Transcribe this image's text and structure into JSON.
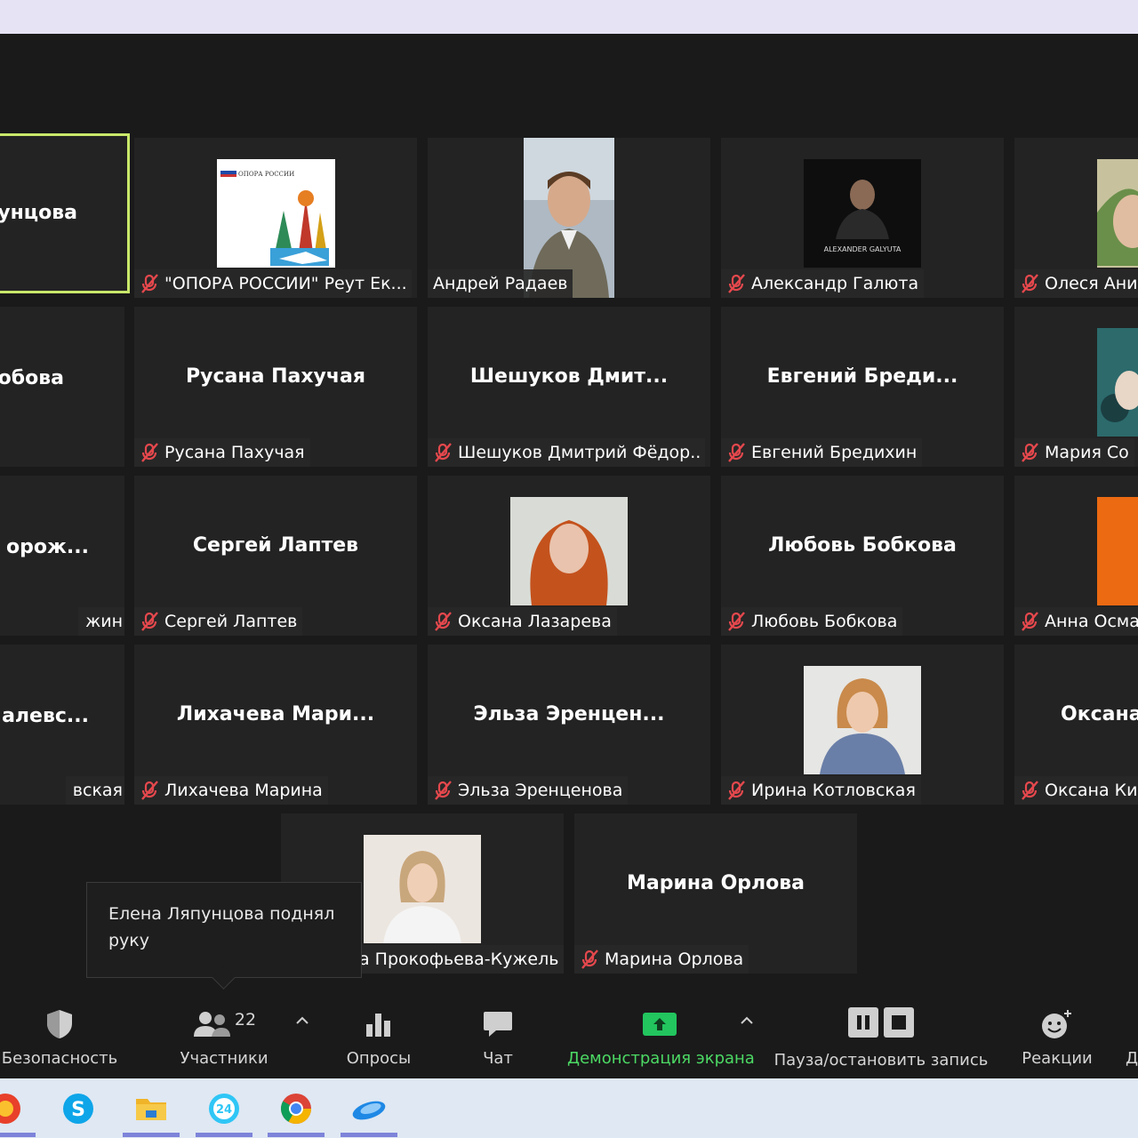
{
  "tiles": [
    {
      "big": "унцова",
      "tag": ""
    },
    {
      "big": "",
      "tag": "\"ОПОРА РОССИИ\" Реут Ек...",
      "logo_text": "ОПОРА РОССИИ"
    },
    {
      "big": "",
      "tag": "Андрей Радаев"
    },
    {
      "big": "",
      "tag": "Александр Галюта",
      "logo_text": "ALEXANDER GALYUTA"
    },
    {
      "big": "",
      "tag": "Олеся Ани"
    },
    {
      "big": "обова",
      "tag": ""
    },
    {
      "big": "Русана Пахучая",
      "tag": "Русана Пахучая"
    },
    {
      "big": "Шешуков  Дмит...",
      "tag": "Шешуков Дмитрий Фёдор..."
    },
    {
      "big": "Евгений  Бреди...",
      "tag": "Евгений Бредихин"
    },
    {
      "big": "",
      "tag": "Мария Со"
    },
    {
      "big": "орож...",
      "tag": "жин"
    },
    {
      "big": "Сергей Лаптев",
      "tag": "Сергей Лаптев"
    },
    {
      "big": "",
      "tag": "Оксана Лазарева"
    },
    {
      "big": "Любовь Бобкова",
      "tag": "Любовь Бобкова"
    },
    {
      "big": "",
      "tag": "Анна Осма"
    },
    {
      "big": "алевс...",
      "tag": "вская"
    },
    {
      "big": "Лихачева  Мари...",
      "tag": "Лихачева Марина"
    },
    {
      "big": "Эльза  Эренцен...",
      "tag": "Эльза Эренценова"
    },
    {
      "big": "",
      "tag": "Ирина Котловская"
    },
    {
      "big": "Оксана",
      "tag": "Оксана Ки"
    },
    {
      "big": "",
      "tag": "а Прокофьева-Кужель"
    },
    {
      "big": "Марина Орлова",
      "tag": "Марина Орлова"
    }
  ],
  "tooltip": "Елена Ляпунцова поднял руку",
  "toolbar": {
    "security": "Безопасность",
    "participants": "Участники",
    "participants_count": "22",
    "polls": "Опросы",
    "chat": "Чат",
    "share": "Демонстрация экрана",
    "record": "Пауза/остановить запись",
    "reactions": "Реакции",
    "more": "Д"
  },
  "colors": {
    "share_green": "#4cd964",
    "active_border": "#c9e86a",
    "mic_red": "#e5484d"
  }
}
